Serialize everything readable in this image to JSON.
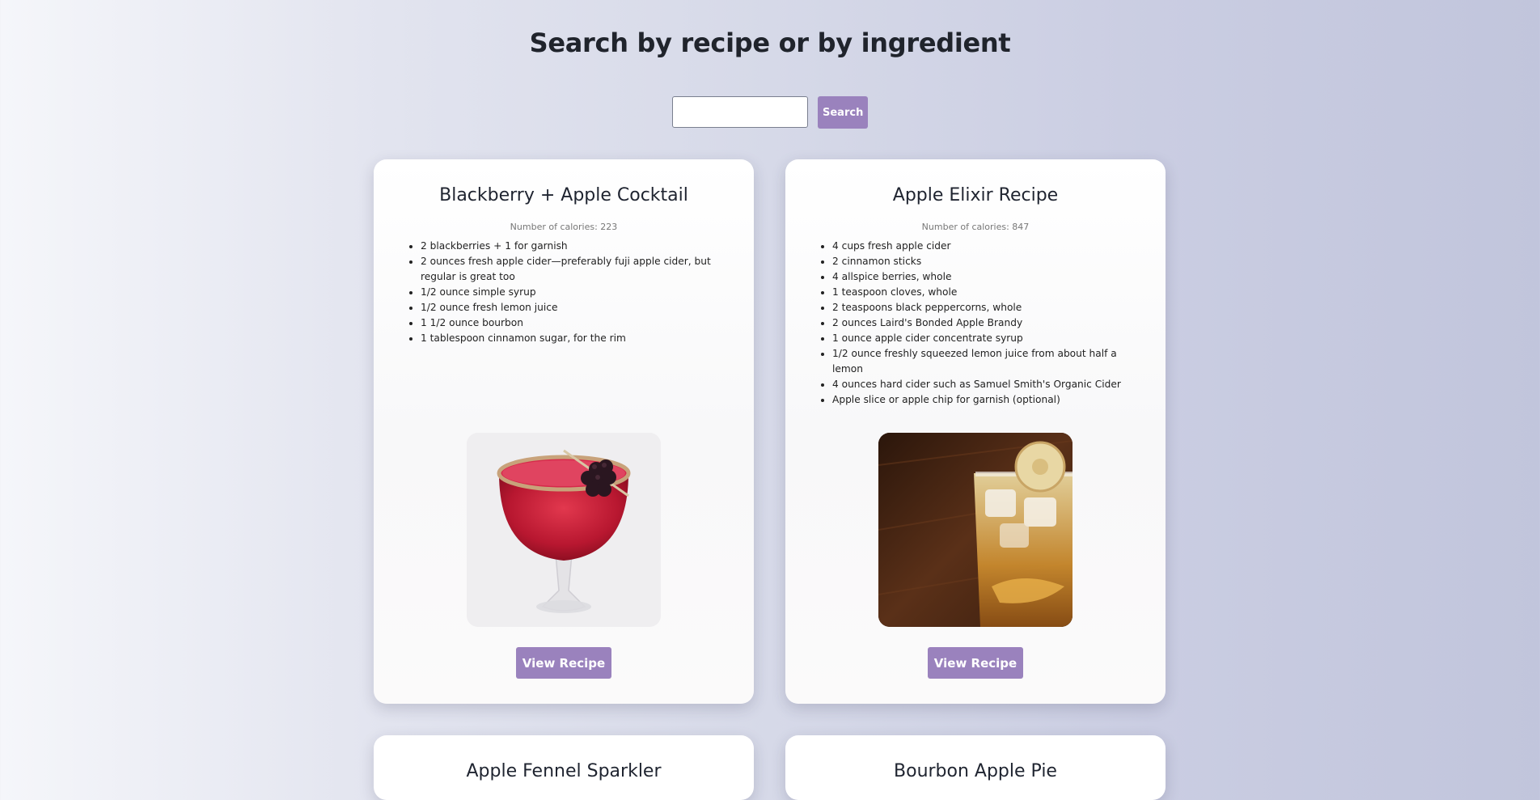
{
  "header": {
    "title": "Search by recipe or by ingredient"
  },
  "search": {
    "value": "",
    "placeholder": "",
    "button_label": "Search"
  },
  "recipes": [
    {
      "title": "Blackberry + Apple Cocktail",
      "calories": "Number of calories: 223",
      "ingredients": [
        "2 blackberries + 1 for garnish",
        "2 ounces fresh apple cider—preferably fuji apple cider, but regular is great too",
        "1/2 ounce simple syrup",
        "1/2 ounce fresh lemon juice",
        "1 1/2 ounce bourbon",
        "1 tablespoon cinnamon sugar, for the rim"
      ],
      "button_label": "View Recipe"
    },
    {
      "title": "Apple Elixir Recipe",
      "calories": "Number of calories: 847",
      "ingredients": [
        "4 cups fresh apple cider",
        "2 cinnamon sticks",
        "4 allspice berries, whole",
        "1 teaspoon cloves, whole",
        "2 teaspoons black peppercorns, whole",
        "2 ounces Laird's Bonded Apple Brandy",
        "1 ounce apple cider concentrate syrup",
        "1/2 ounce freshly squeezed lemon juice from about half a lemon",
        "4 ounces hard cider such as Samuel Smith's Organic Cider",
        "Apple slice or apple chip for garnish (optional)"
      ],
      "button_label": "View Recipe"
    },
    {
      "title": "Apple Fennel Sparkler"
    },
    {
      "title": "Bourbon Apple Pie"
    }
  ],
  "colors": {
    "accent": "#9a82bd"
  }
}
